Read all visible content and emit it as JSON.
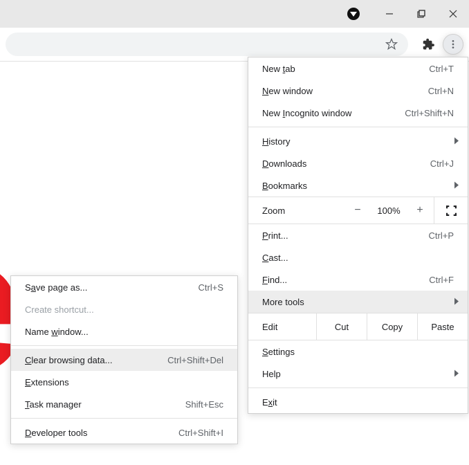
{
  "main_menu": {
    "new_tab": "New tab",
    "new_tab_u": "t",
    "new_tab_sc": "Ctrl+T",
    "new_window": "New window",
    "new_window_u": "N",
    "new_window_sc": "Ctrl+N",
    "incognito": "New Incognito window",
    "incognito_u": "I",
    "incognito_sc": "Ctrl+Shift+N",
    "history": "History",
    "history_u": "H",
    "downloads": "Downloads",
    "downloads_u": "D",
    "downloads_sc": "Ctrl+J",
    "bookmarks": "Bookmarks",
    "bookmarks_u": "B",
    "zoom_label": "Zoom",
    "zoom_value": "100%",
    "print": "Print...",
    "print_u": "P",
    "print_sc": "Ctrl+P",
    "cast": "Cast...",
    "cast_u": "C",
    "find": "Find...",
    "find_u": "F",
    "find_sc": "Ctrl+F",
    "more_tools": "More tools",
    "more_tools_u": "",
    "edit_label": "Edit",
    "cut": "Cut",
    "copy": "Copy",
    "paste": "Paste",
    "settings": "Settings",
    "settings_u": "S",
    "help": "Help",
    "help_u": "",
    "exit": "Exit",
    "exit_u": "x"
  },
  "sub_menu": {
    "save_page": "Save page as...",
    "save_page_u": "a",
    "save_page_sc": "Ctrl+S",
    "create_shortcut": "Create shortcut...",
    "name_window": "Name window...",
    "name_window_u": "w",
    "clear_data": "Clear browsing data...",
    "clear_data_u": "C",
    "clear_data_sc": "Ctrl+Shift+Del",
    "extensions": "Extensions",
    "extensions_u": "E",
    "task_manager": "Task manager",
    "task_manager_u": "T",
    "task_manager_sc": "Shift+Esc",
    "dev_tools": "Developer tools",
    "dev_tools_u": "D",
    "dev_tools_sc": "Ctrl+Shift+I"
  }
}
